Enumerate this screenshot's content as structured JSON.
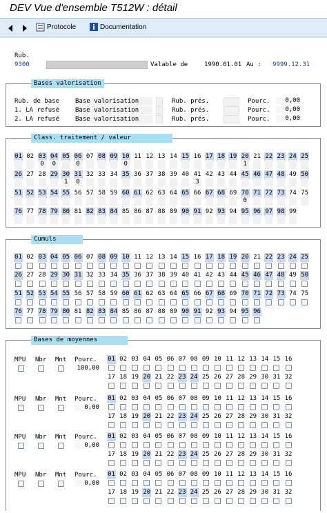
{
  "title": "DEV Vue d'ensemble T512W : détail",
  "toolbar": {
    "protocole": "Protocole",
    "documentation": "Documentation"
  },
  "header": {
    "rub_label": "Rub.",
    "rub_value": "9300",
    "valable_label": "Valable de",
    "from": "1990.01.01",
    "au_label": "Au :",
    "to": "9999.12.31"
  },
  "bases_valorisation": {
    "title": "Bases valorisation",
    "rows": [
      {
        "label": "Rub. de base",
        "base": "Base valorisation",
        "pres": "Rub. prés.",
        "pourc": "Pourc.",
        "value": "0,00"
      },
      {
        "label": "1. LA refusé",
        "base": "Base valorisation",
        "pres": "Rub. prés.",
        "pourc": "Pourc.",
        "value": "0,00"
      },
      {
        "label": "2. LA refusé",
        "base": "Base valorisation",
        "pres": "Rub. prés.",
        "pourc": "Pourc.",
        "value": "0,00"
      }
    ]
  },
  "class_traitement": {
    "title": "Class. traitement / valeur",
    "row1": [
      "01",
      "02",
      "03",
      "04",
      "05",
      "06",
      "07",
      "08",
      "09",
      "10",
      "11",
      "12",
      "13",
      "14",
      "15",
      "16",
      "17",
      "18",
      "19",
      "20",
      "21",
      "22",
      "23",
      "24",
      "25"
    ],
    "row1_vals": [
      "",
      "",
      "0",
      "0",
      "",
      "0",
      "",
      "",
      "",
      "0",
      "",
      "",
      "",
      "",
      "",
      "",
      "",
      "",
      "",
      "1",
      "",
      "",
      "",
      "",
      ""
    ],
    "row2": [
      "26",
      "27",
      "28",
      "29",
      "30",
      "31",
      "32",
      "33",
      "34",
      "35",
      "36",
      "37",
      "38",
      "39",
      "40",
      "41",
      "42",
      "43",
      "44",
      "45",
      "46",
      "47",
      "48",
      "49",
      "50"
    ],
    "row2_vals": [
      "",
      "",
      "",
      "",
      "1",
      "0",
      "",
      "",
      "",
      "",
      "",
      "",
      "",
      "",
      "",
      "3",
      "",
      "",
      "",
      "",
      "",
      "",
      "",
      "",
      ""
    ],
    "row3": [
      "51",
      "52",
      "53",
      "54",
      "55",
      "56",
      "57",
      "58",
      "59",
      "60",
      "61",
      "62",
      "63",
      "64",
      "65",
      "66",
      "67",
      "68",
      "69",
      "70",
      "71",
      "72",
      "73",
      "74",
      "75"
    ],
    "row3_vals": [
      "",
      "",
      "",
      "",
      "",
      "",
      "",
      "",
      "",
      "",
      "",
      "",
      "",
      "",
      "",
      "",
      "",
      "",
      "",
      "0",
      "",
      "",
      "",
      "",
      ""
    ],
    "row4": [
      "76",
      "77",
      "78",
      "79",
      "80",
      "81",
      "82",
      "83",
      "84",
      "85",
      "86",
      "87",
      "88",
      "89",
      "90",
      "91",
      "92",
      "93",
      "94",
      "95",
      "96",
      "97",
      "98",
      "99"
    ]
  },
  "cumuls": {
    "title": "Cumuls",
    "row1": [
      "01",
      "02",
      "03",
      "04",
      "05",
      "06",
      "07",
      "08",
      "09",
      "10",
      "11",
      "12",
      "13",
      "14",
      "15",
      "16",
      "17",
      "18",
      "19",
      "20",
      "21",
      "22",
      "23",
      "24",
      "25"
    ],
    "row2": [
      "26",
      "27",
      "28",
      "29",
      "30",
      "31",
      "32",
      "33",
      "34",
      "35",
      "36",
      "37",
      "38",
      "39",
      "40",
      "41",
      "42",
      "43",
      "44",
      "45",
      "46",
      "47",
      "48",
      "49",
      "50"
    ],
    "row3": [
      "51",
      "52",
      "53",
      "54",
      "55",
      "56",
      "57",
      "58",
      "59",
      "60",
      "61",
      "62",
      "63",
      "64",
      "65",
      "66",
      "67",
      "68",
      "69",
      "70",
      "71",
      "72",
      "73",
      "74",
      "75"
    ],
    "row4": [
      "76",
      "77",
      "78",
      "79",
      "80",
      "81",
      "82",
      "83",
      "84",
      "85",
      "86",
      "87",
      "88",
      "89",
      "90",
      "91",
      "92",
      "93",
      "94",
      "95",
      "96"
    ]
  },
  "bases_moyennes": {
    "title": "Bases de moyennes",
    "mpu": "MPU",
    "nbr": "Nbr",
    "mnt": "Mnt",
    "pourc": "Pourc.",
    "pourc_values": [
      "100,00",
      "0,00",
      "0,00",
      "0,00"
    ],
    "row1": [
      "01",
      "02",
      "03",
      "04",
      "05",
      "06",
      "07",
      "08",
      "09",
      "10",
      "11",
      "12",
      "13",
      "14",
      "15",
      "16"
    ],
    "row2": [
      "17",
      "18",
      "19",
      "20",
      "21",
      "22",
      "23",
      "24",
      "25",
      "26",
      "27",
      "28",
      "29",
      "30",
      "31",
      "32"
    ]
  }
}
